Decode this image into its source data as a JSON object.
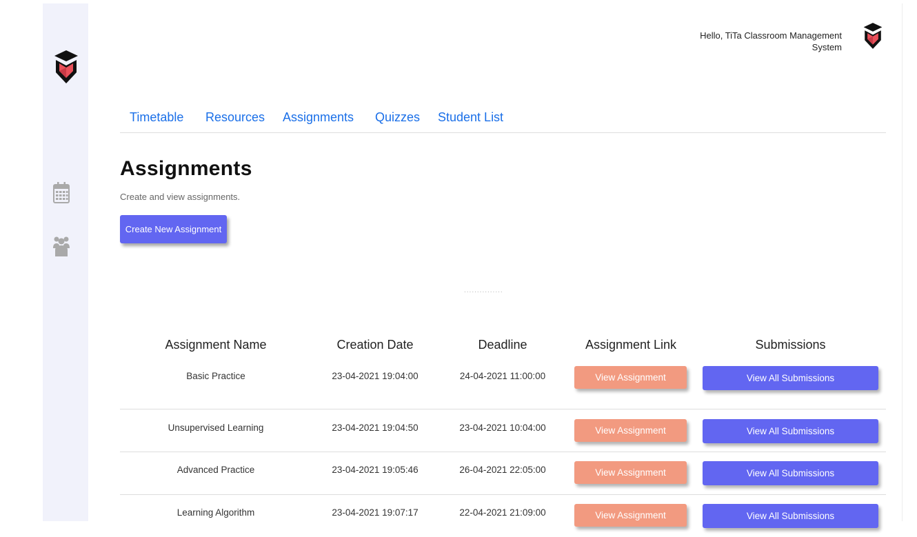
{
  "brand": {
    "logo_icon": "graduation-cap-hexagon-icon",
    "accent": "#e9505a"
  },
  "header": {
    "greeting_line1": "Hello, TiTa Classroom Management",
    "greeting_line2": "System",
    "avatar_icon": "graduation-cap-hexagon-icon"
  },
  "sidebar": {
    "items": [
      {
        "icon": "calendar-icon"
      },
      {
        "icon": "users-icon"
      }
    ]
  },
  "tabs": [
    {
      "label": "Timetable"
    },
    {
      "label": "Resources"
    },
    {
      "label": "Assignments"
    },
    {
      "label": "Quizzes"
    },
    {
      "label": "Student List"
    }
  ],
  "page": {
    "title": "Assignments",
    "subtitle": "Create and view assignments.",
    "create_button": "Create New Assignment",
    "loading_indicator": "..............."
  },
  "table": {
    "headers": [
      "Assignment Name",
      "Creation Date",
      "Deadline",
      "Assignment Link",
      "Submissions"
    ],
    "rows": [
      {
        "name": "Basic Practice",
        "created": "23-04-2021 19:04:00",
        "deadline": "24-04-2021 11:00:00",
        "link_label": "View Assignment",
        "subs_label": "View All Submissions"
      },
      {
        "name": "Unsupervised Learning",
        "created": "23-04-2021 19:04:50",
        "deadline": "23-04-2021 10:04:00",
        "link_label": "View Assignment",
        "subs_label": "View All Submissions"
      },
      {
        "name": "Advanced Practice",
        "created": "23-04-2021 19:05:46",
        "deadline": "26-04-2021 22:05:00",
        "link_label": "View Assignment",
        "subs_label": "View All Submissions"
      },
      {
        "name": "Learning Algorithm",
        "created": "23-04-2021 19:07:17",
        "deadline": "22-04-2021 21:09:00",
        "link_label": "View Assignment",
        "subs_label": "View All Submissions"
      }
    ]
  },
  "colors": {
    "primary": "#6266f1",
    "secondary": "#f29a80",
    "link": "#1a6fe8",
    "sidebar_bg": "#f1f2fb"
  }
}
